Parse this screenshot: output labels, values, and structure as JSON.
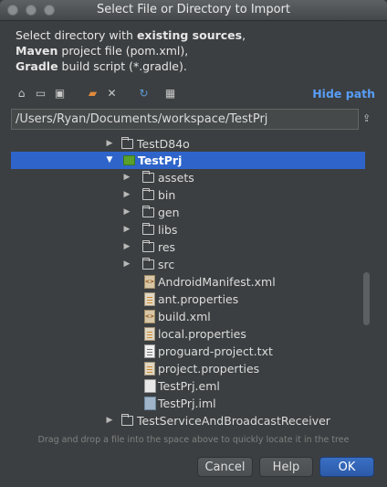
{
  "window": {
    "title": "Select File or Directory to Import"
  },
  "description": {
    "line1_pre": "Select directory with ",
    "line1_bold": "existing sources",
    "line1_post": ",",
    "line2_bold": "Maven",
    "line2_post": " project file (pom.xml),",
    "line3_bold": "Gradle",
    "line3_post": " build script (*.gradle)."
  },
  "toolbar": {
    "icons": [
      "home-icon",
      "desktop-icon",
      "project-folder-icon",
      "new-folder-icon",
      "delete-icon",
      "refresh-icon",
      "show-hidden-icon"
    ],
    "hide_path_label": "Hide path"
  },
  "path": {
    "value": "/Users/Ryan/Documents/workspace/TestPrj"
  },
  "tree": {
    "rows": [
      {
        "label": "TestD84o",
        "type": "folder",
        "expanded": false,
        "selected": false
      },
      {
        "label": "TestPrj",
        "type": "module",
        "expanded": true,
        "selected": true
      },
      {
        "label": "assets",
        "type": "folder",
        "expanded": false,
        "selected": false
      },
      {
        "label": "bin",
        "type": "folder",
        "expanded": false,
        "selected": false
      },
      {
        "label": "gen",
        "type": "folder",
        "expanded": false,
        "selected": false
      },
      {
        "label": "libs",
        "type": "folder",
        "expanded": false,
        "selected": false
      },
      {
        "label": "res",
        "type": "folder",
        "expanded": false,
        "selected": false
      },
      {
        "label": "src",
        "type": "folder",
        "expanded": false,
        "selected": false
      },
      {
        "label": "AndroidManifest.xml",
        "type": "xml",
        "selected": false
      },
      {
        "label": "ant.properties",
        "type": "properties",
        "selected": false
      },
      {
        "label": "build.xml",
        "type": "xml",
        "selected": false
      },
      {
        "label": "local.properties",
        "type": "properties",
        "selected": false
      },
      {
        "label": "proguard-project.txt",
        "type": "txt",
        "selected": false
      },
      {
        "label": "project.properties",
        "type": "properties",
        "selected": false
      },
      {
        "label": "TestPrj.eml",
        "type": "eml",
        "selected": false
      },
      {
        "label": "TestPrj.iml",
        "type": "iml",
        "selected": false
      },
      {
        "label": "TestServiceAndBroadcastReceiver",
        "type": "folder",
        "expanded": false,
        "selected": false
      }
    ]
  },
  "hint": "Drag and drop a file into the space above to quickly locate it in the tree",
  "buttons": {
    "cancel": "Cancel",
    "help": "Help",
    "ok": "OK"
  },
  "colors": {
    "background": "#3c3f41",
    "selection": "#2f65ca",
    "link": "#589df6",
    "text": "#dcdcdc"
  }
}
